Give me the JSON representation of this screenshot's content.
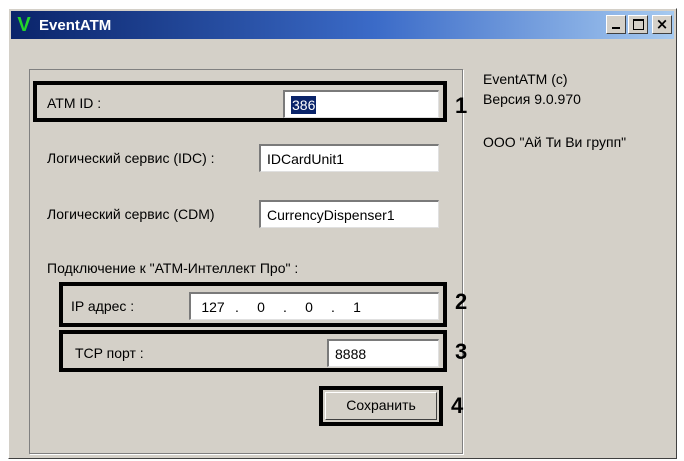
{
  "window": {
    "title": "EventATM",
    "icon_glyph": "V",
    "icon": "app-v-icon",
    "buttons": {
      "minimize": "minimize-icon",
      "maximize": "maximize-icon",
      "close_glyph": "×"
    }
  },
  "form": {
    "atm_id": {
      "label": "ATM ID :",
      "value": "386"
    },
    "idc": {
      "label": "Логический сервис (IDC) :",
      "value": "IDCardUnit1"
    },
    "cdm": {
      "label": "Логический сервис (CDM)",
      "value": "CurrencyDispenser1"
    },
    "connection_label": "Подключение к \"АТМ-Интеллект Про\" :",
    "ip": {
      "label": "IP адрес :",
      "octets": [
        "127",
        "0",
        "0",
        "1"
      ],
      "dot": "."
    },
    "tcp": {
      "label": "TCP порт :",
      "value": "8888"
    },
    "save_label": "Сохранить"
  },
  "callouts": [
    "1",
    "2",
    "3",
    "4"
  ],
  "info": {
    "app_name": "EventATM (c)",
    "version": "Версия 9.0.970",
    "company": "ООО \"Ай Ти Ви групп\""
  }
}
